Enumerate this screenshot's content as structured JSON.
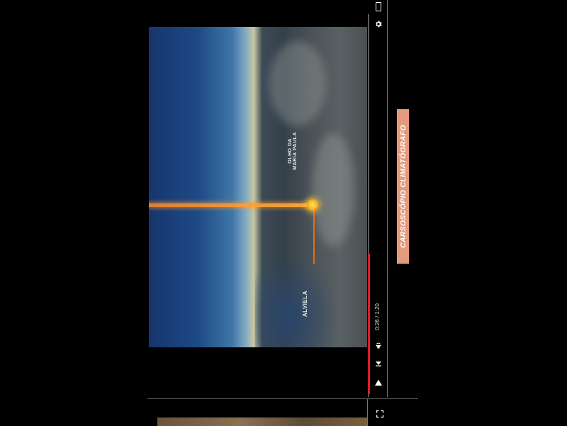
{
  "video": {
    "place_labels": [
      "OLHO DA\nMARIA PAULA",
      "ALVIELA"
    ],
    "icons": {
      "marker": "location-marker-icon"
    }
  },
  "controls": {
    "time": "0:26 / 1:20",
    "progress": 0.33,
    "icons": [
      "portrait-icon",
      "settings-icon",
      "volume-icon",
      "next-icon",
      "play-icon"
    ]
  },
  "title": {
    "text": "CARSOSCÓPIO CLIMATÓGRAFO",
    "background": "#e49a7c"
  },
  "second_player": {
    "icons": [
      "fullscreen-icon"
    ]
  },
  "colors": {
    "progress": "#e01c1c",
    "path": "#ff9a2e"
  }
}
